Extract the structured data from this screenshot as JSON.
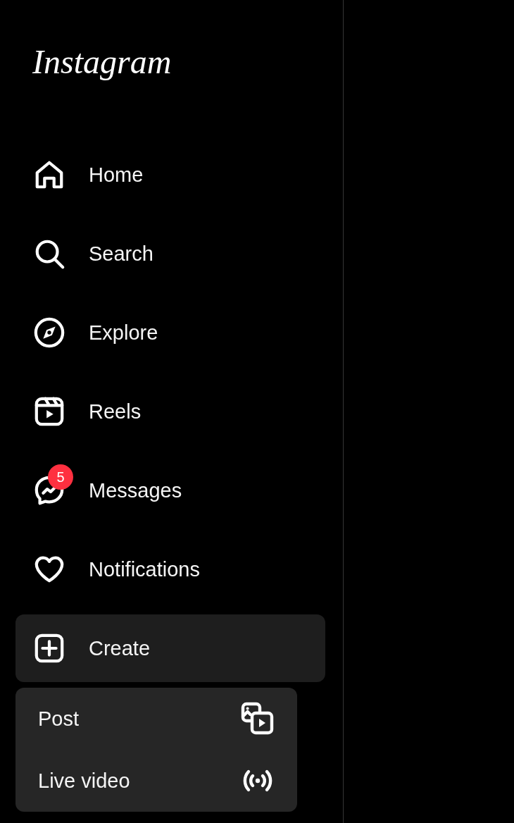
{
  "logo": "Instagram",
  "nav": [
    {
      "label": "Home",
      "kind": "home",
      "selected": false
    },
    {
      "label": "Search",
      "kind": "search",
      "selected": false
    },
    {
      "label": "Explore",
      "kind": "explore",
      "selected": false
    },
    {
      "label": "Reels",
      "kind": "reels",
      "selected": false
    },
    {
      "label": "Messages",
      "kind": "messages",
      "selected": false,
      "badge": "5"
    },
    {
      "label": "Notifications",
      "kind": "heart",
      "selected": false
    },
    {
      "label": "Create",
      "kind": "create",
      "selected": true
    }
  ],
  "create_menu": [
    {
      "label": "Post",
      "kind": "post"
    },
    {
      "label": "Live video",
      "kind": "live"
    }
  ]
}
